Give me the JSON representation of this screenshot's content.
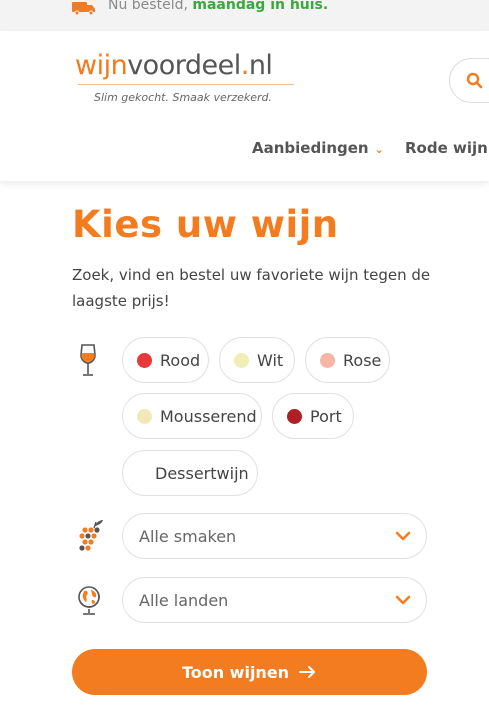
{
  "topbar": {
    "text_prefix": "Nu besteld,",
    "text_highlight": "maandag in huis."
  },
  "logo": {
    "part1": "wijn",
    "part2": "voordeel",
    "dot": ".",
    "part3": "nl",
    "tagline": "Slim gekocht. Smaak verzekerd."
  },
  "nav": {
    "items": [
      {
        "label": "Aanbiedingen"
      },
      {
        "label": "Rode wijn"
      }
    ]
  },
  "main": {
    "title": "Kies uw wijn",
    "intro": "Zoek, vind en bestel uw favoriete wijn tegen de laagste prijs!",
    "wine_types": [
      {
        "label": "Rood",
        "color": "#e8393a"
      },
      {
        "label": "Wit",
        "color": "#eeeeb6"
      },
      {
        "label": "Rose",
        "color": "#f7b5a6"
      },
      {
        "label": "Mousserend",
        "color": "#f1e8b9"
      },
      {
        "label": "Port",
        "color": "#b01f25"
      },
      {
        "label": "Dessertwijn",
        "color": ""
      }
    ],
    "taste_select": {
      "value": "Alle smaken"
    },
    "country_select": {
      "value": "Alle landen"
    },
    "cta_label": "Toon wijnen"
  },
  "colors": {
    "accent": "#f47c20",
    "highlight_green": "#3aa83a"
  },
  "icons": [
    "truck-icon",
    "search-icon",
    "chevron-down-icon",
    "wine-glass-icon",
    "grapes-icon",
    "globe-icon",
    "arrow-right-icon"
  ]
}
